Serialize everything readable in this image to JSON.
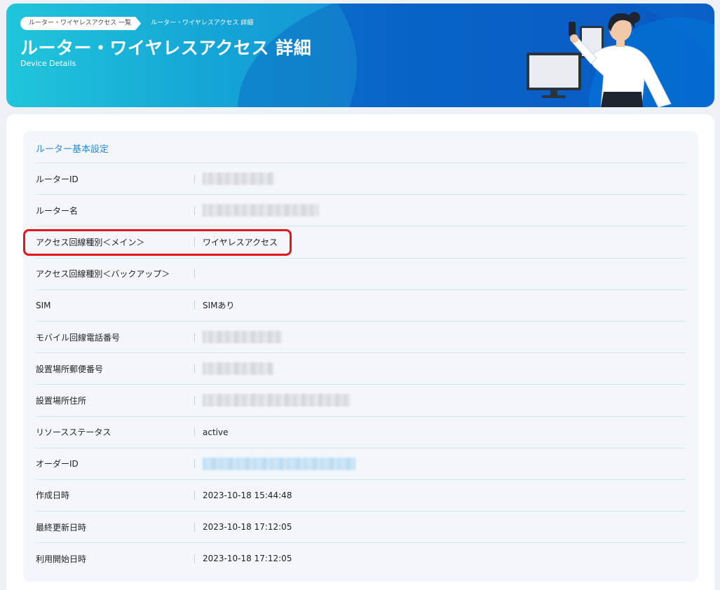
{
  "header": {
    "breadcrumb": {
      "list_label": "ルーター・ワイヤレスアクセス 一覧",
      "current_label": "ルーター・ワイヤレスアクセス 詳細"
    },
    "title": "ルーター・ワイヤレスアクセス 詳細",
    "subtitle": "Device Details"
  },
  "section": {
    "title": "ルーター基本設定",
    "rows": [
      {
        "label": "ルーターID",
        "value": "",
        "masked": true
      },
      {
        "label": "ルーター名",
        "value": "",
        "masked": true
      },
      {
        "label": "アクセス回線種別＜メイン＞",
        "value": "ワイヤレスアクセス"
      },
      {
        "label": "アクセス回線種別＜バックアップ＞",
        "value": ""
      },
      {
        "label": "SIM",
        "value": "SIMあり"
      },
      {
        "label": "モバイル回線電話番号",
        "value": "",
        "masked": true
      },
      {
        "label": "設置場所郵便番号",
        "value": "",
        "masked": true
      },
      {
        "label": "設置場所住所",
        "value": "",
        "masked": true
      },
      {
        "label": "リソースステータス",
        "value": "active"
      },
      {
        "label": "オーダーID",
        "value": "",
        "masked": true,
        "link": true
      },
      {
        "label": "作成日時",
        "value": "2023-10-18 15:44:48"
      },
      {
        "label": "最終更新日時",
        "value": "2023-10-18 17:12:05"
      },
      {
        "label": "利用開始日時",
        "value": "2023-10-18 17:12:05"
      }
    ]
  },
  "colors": {
    "accent": "#2b8ad8",
    "highlight": "#e3141b",
    "banner_start": "#1cc0d6",
    "banner_end": "#0a5fc6"
  }
}
